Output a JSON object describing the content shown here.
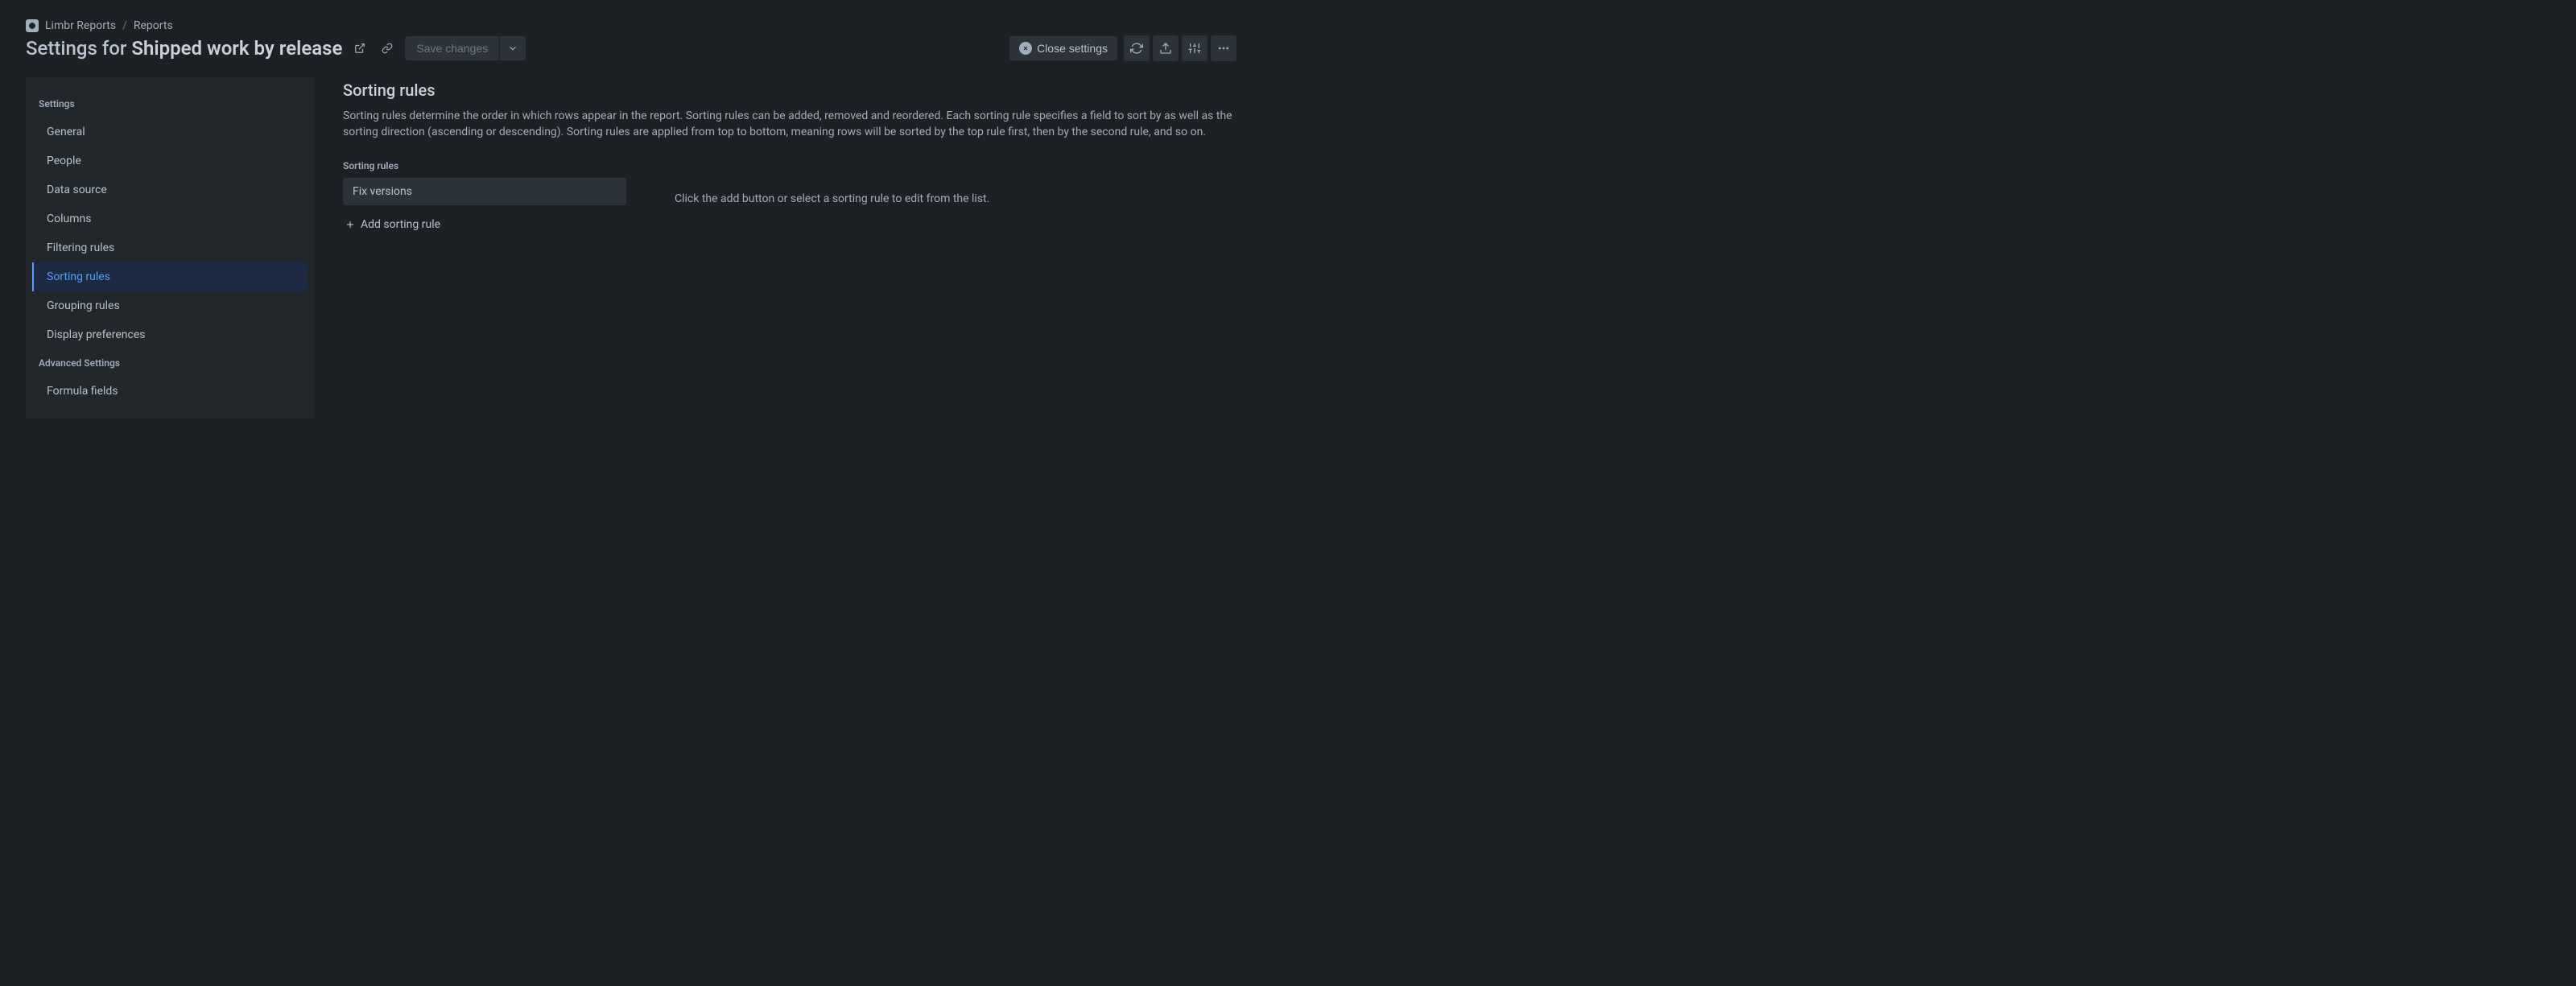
{
  "breadcrumb": {
    "app_name": "Limbr Reports",
    "section": "Reports"
  },
  "header": {
    "title_prefix": "Settings for ",
    "title_name": "Shipped work by release",
    "save_label": "Save changes",
    "close_label": "Close settings"
  },
  "sidebar": {
    "group1_heading": "Settings",
    "group2_heading": "Advanced Settings",
    "items": [
      {
        "label": "General",
        "active": false
      },
      {
        "label": "People",
        "active": false
      },
      {
        "label": "Data source",
        "active": false
      },
      {
        "label": "Columns",
        "active": false
      },
      {
        "label": "Filtering rules",
        "active": false
      },
      {
        "label": "Sorting rules",
        "active": true
      },
      {
        "label": "Grouping rules",
        "active": false
      },
      {
        "label": "Display preferences",
        "active": false
      }
    ],
    "advanced_items": [
      {
        "label": "Formula fields",
        "active": false
      }
    ]
  },
  "main": {
    "title": "Sorting rules",
    "description": "Sorting rules determine the order in which rows appear in the report. Sorting rules can be added, removed and reordered. Each sorting rule specifies a field to sort by as well as the sorting direction (ascending or descending). Sorting rules are applied from top to bottom, meaning rows will be sorted by the top rule first, then by the second rule, and so on.",
    "rules_label": "Sorting rules",
    "rules": [
      {
        "label": "Fix versions"
      }
    ],
    "add_label": "Add sorting rule",
    "hint": "Click the add button or select a sorting rule to edit from the list."
  }
}
